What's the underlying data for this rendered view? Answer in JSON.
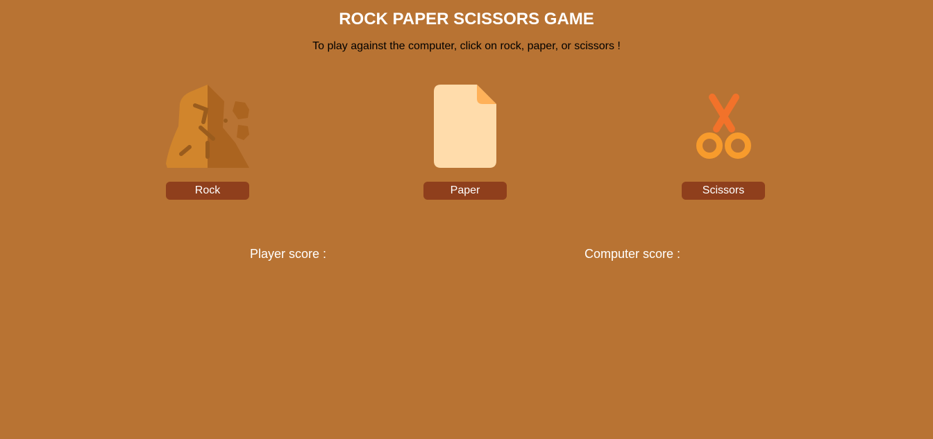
{
  "header": {
    "title": "ROCK PAPER SCISSORS GAME",
    "instructions": "To play against the computer, click on rock, paper, or scissors !"
  },
  "choices": [
    {
      "label": "Rock",
      "icon": "rock-icon"
    },
    {
      "label": "Paper",
      "icon": "paper-icon"
    },
    {
      "label": "Scissors",
      "icon": "scissors-icon"
    }
  ],
  "scores": {
    "player_label": "Player score :",
    "computer_label": "Computer score :"
  },
  "colors": {
    "background": "#b87333",
    "button": "#8f3f1c",
    "text_light": "#ffffff",
    "text_dark": "#000000"
  }
}
